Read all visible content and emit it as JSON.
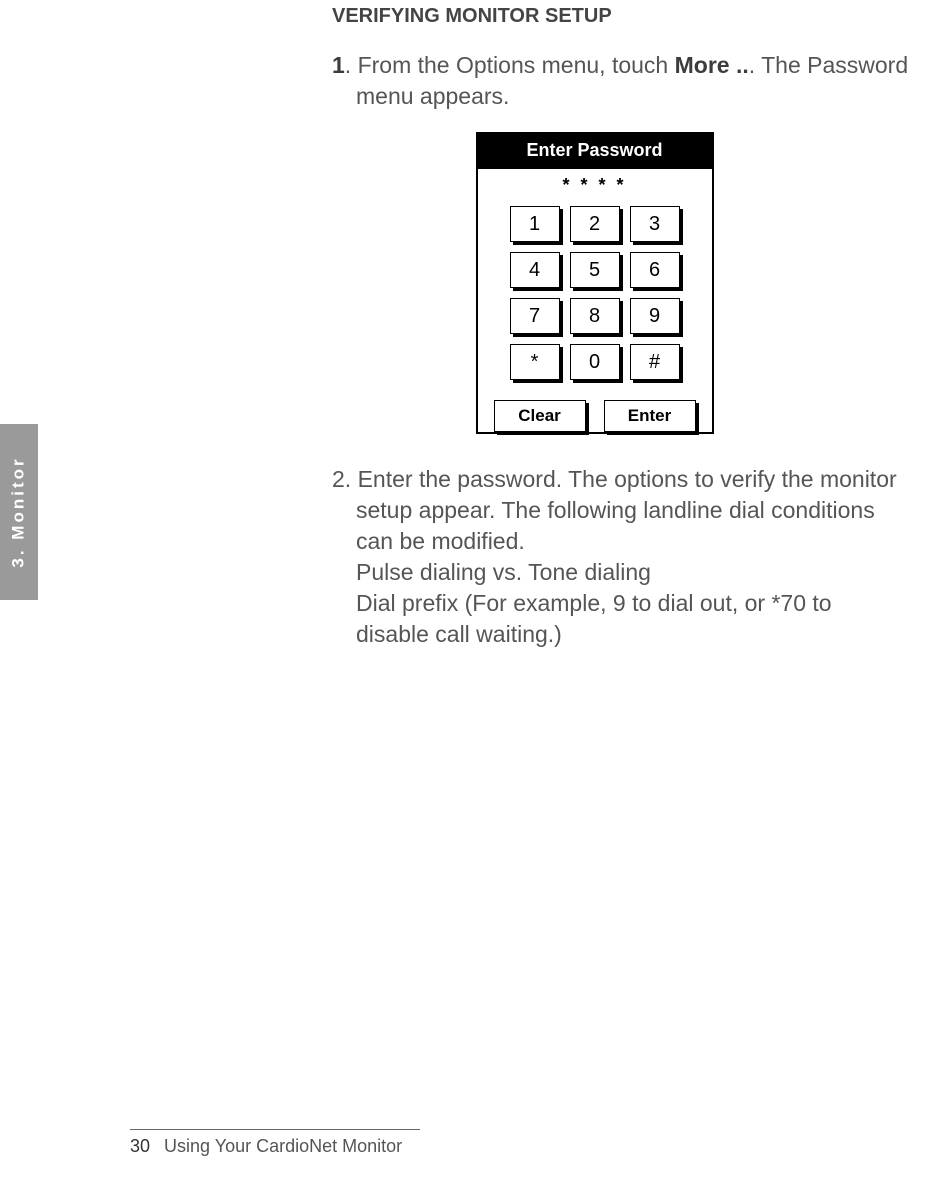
{
  "side_tab": "3.  Monitor",
  "content": {
    "section_title": "VERIFYING MONITOR SETUP",
    "step1_num": "1",
    "step1_line1a": ". From the Options menu, touch ",
    "step1_bold": "More ..",
    "step1_line1b": ". The Password",
    "step1_line2": "menu appears.",
    "step2_num": "2.",
    "step2_line1": " Enter the password. The options to verify the monitor",
    "step2_line2": "setup appear. The following landline dial conditions",
    "step2_line3": "can be modified.",
    "step2_sub1": "Pulse dialing vs. Tone dialing",
    "step2_sub2a": "Dial prefix (For example, 9 to dial out, or *70 to",
    "step2_sub2b": "disable call waiting.)"
  },
  "keypad": {
    "title": "Enter Password",
    "display": "* * * *",
    "keys": [
      "1",
      "2",
      "3",
      "4",
      "5",
      "6",
      "7",
      "8",
      "9",
      "*",
      "0",
      "#"
    ],
    "clear_label": "Clear",
    "enter_label": "Enter"
  },
  "footer": {
    "page_num": "30",
    "title": "Using Your CardioNet Monitor"
  }
}
